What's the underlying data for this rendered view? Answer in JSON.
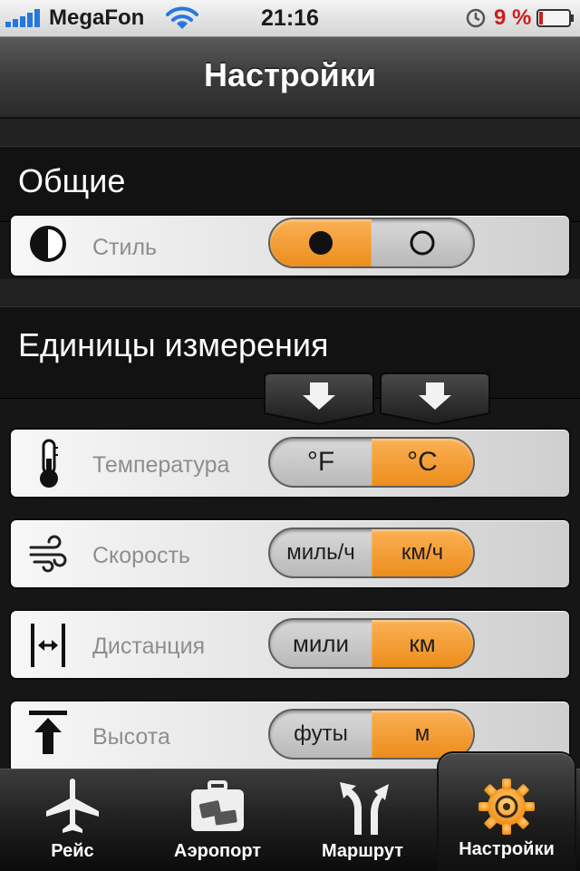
{
  "status_bar": {
    "carrier": "MegaFon",
    "time": "21:16",
    "battery_percent": "9 %",
    "signal_icon": "signal-bars-icon",
    "wifi_icon": "wifi-icon",
    "alarm_icon": "clock-icon",
    "battery_level": 0.09
  },
  "nav": {
    "title": "Настройки"
  },
  "sections": {
    "general": {
      "title": "Общие",
      "style": {
        "label": "Стиль",
        "icon": "half-circle-icon",
        "selected": "dark"
      }
    },
    "units": {
      "title": "Единицы измерения",
      "rows": [
        {
          "label": "Температура",
          "icon": "thermometer-icon",
          "left": "°F",
          "right": "°C",
          "selected": "right"
        },
        {
          "label": "Скорость",
          "icon": "wind-icon",
          "left": "миль/ч",
          "right": "км/ч",
          "selected": "right"
        },
        {
          "label": "Дистанция",
          "icon": "distance-icon",
          "left": "мили",
          "right": "км",
          "selected": "right"
        },
        {
          "label": "Высота",
          "icon": "altitude-icon",
          "left": "футы",
          "right": "м",
          "selected": "right"
        }
      ]
    }
  },
  "tabs": [
    {
      "label": "Рейс",
      "icon": "airplane-icon"
    },
    {
      "label": "Аэропорт",
      "icon": "suitcase-icon"
    },
    {
      "label": "Маршрут",
      "icon": "route-arrows-icon"
    },
    {
      "label": "Настройки",
      "icon": "gear-icon",
      "active": true
    }
  ],
  "colors": {
    "accent": "#f39a2a",
    "signal": "#2777e0",
    "battery_low": "#c91f1f"
  }
}
